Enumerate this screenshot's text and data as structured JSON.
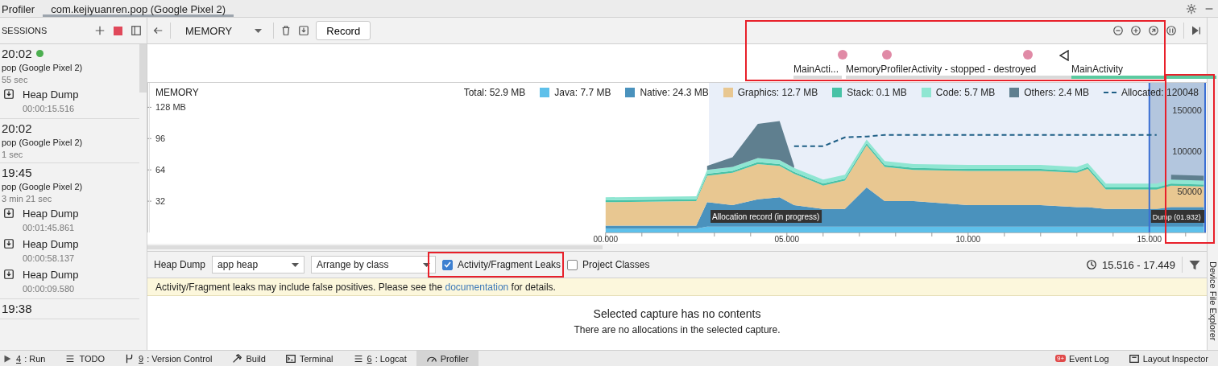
{
  "title_bar": {
    "tabs": [
      {
        "label": "Profiler",
        "selected": false
      },
      {
        "label": "com.kejiyuanren.pop (Google Pixel 2)",
        "selected": true
      }
    ]
  },
  "sessions": {
    "title": "SESSIONS",
    "items": [
      {
        "time": "20:02",
        "live": true,
        "device": "pop (Google Pixel 2)",
        "duration": "55 sec",
        "dumps": [
          {
            "label": "Heap Dump",
            "time": "00:00:15.516"
          }
        ]
      },
      {
        "time": "20:02",
        "live": false,
        "device": "pop (Google Pixel 2)",
        "duration": "1 sec"
      },
      {
        "time": "19:45",
        "live": false,
        "device": "pop (Google Pixel 2)",
        "duration": "3 min 21 sec",
        "dumps": [
          {
            "label": "Heap Dump",
            "time": "00:01:45.861"
          },
          {
            "label": "Heap Dump",
            "time": "00:00:58.137"
          },
          {
            "label": "Heap Dump",
            "time": "00:00:09.580"
          }
        ]
      },
      {
        "time": "19:38",
        "live": false
      }
    ]
  },
  "toolbar": {
    "profiler": "MEMORY",
    "record_button": "Record"
  },
  "events": {
    "highlighted": true,
    "marks": [
      {
        "kind": "touch"
      },
      {
        "kind": "touch"
      },
      {
        "kind": "touch"
      },
      {
        "kind": "back"
      }
    ],
    "activities": [
      {
        "label": "MainActi...",
        "active": false
      },
      {
        "label": "MemoryProfilerActivity - stopped - destroyed",
        "active": false
      },
      {
        "label": "MainActivity",
        "active": true
      }
    ]
  },
  "memory": {
    "title": "MEMORY",
    "total": "Total: 52.9 MB",
    "dump_highlighted": true,
    "ranges": [
      {
        "label": "Allocation record (in progress)"
      },
      {
        "label": "Dump (01.932)"
      }
    ],
    "chart_data": {
      "type": "area",
      "stacked": true,
      "xlim": [
        -12.64,
        16.56
      ],
      "ylim": [
        0,
        153
      ],
      "x": [
        0,
        2.5,
        2.8,
        3.5,
        4.2,
        4.8,
        5.2,
        6,
        6.6,
        7.2,
        7.7,
        8.5,
        10,
        12,
        13,
        13.3,
        13.8,
        15.2,
        15.6,
        16.5
      ],
      "xticks": [
        {
          "value": 0,
          "label": "00.000"
        },
        {
          "value": 5,
          "label": "05.000"
        },
        {
          "value": 10,
          "label": "10.000"
        },
        {
          "value": 15,
          "label": "15.000"
        }
      ],
      "yticks": [
        32,
        64,
        96,
        {
          "value": 128,
          "label": "128 MB"
        }
      ],
      "series": [
        {
          "name": "Java: 7.7 MB",
          "color": "#5ec0ea",
          "values": [
            4,
            4,
            6,
            6,
            6,
            6,
            6,
            6,
            6,
            6,
            6,
            6,
            6,
            6,
            6,
            6,
            6,
            6,
            6,
            6
          ]
        },
        {
          "name": "Native: 24.3 MB",
          "color": "#4a92bd",
          "values": [
            3,
            3,
            25,
            22,
            28,
            30,
            22,
            18,
            18,
            40,
            26,
            26,
            22,
            22,
            20,
            20,
            18,
            18,
            20,
            20
          ]
        },
        {
          "name": "Graphics: 12.7 MB",
          "color": "#e8c791",
          "values": [
            24,
            25,
            27,
            33,
            36,
            32,
            32,
            24,
            29,
            43,
            35,
            32,
            35,
            35,
            35,
            39,
            20,
            20,
            22,
            21
          ]
        },
        {
          "name": "Stack: 0.1 MB",
          "color": "#47c2a6",
          "values": [
            2,
            2,
            2,
            2,
            2,
            2,
            2,
            2,
            2,
            2,
            2,
            2,
            2,
            2,
            2,
            2,
            2,
            2,
            2,
            2
          ]
        },
        {
          "name": "Code: 5.7 MB",
          "color": "#8fe6d2",
          "values": [
            3,
            3,
            4,
            4,
            4,
            4,
            4,
            4,
            4,
            4,
            4,
            4,
            4,
            4,
            4,
            4,
            4,
            4,
            4,
            4
          ]
        },
        {
          "name": "Others: 2.4 MB",
          "color": "#5f7f8f",
          "values": [
            null,
            null,
            4,
            10,
            35,
            40,
            2,
            null,
            null,
            null,
            null,
            null,
            null,
            null,
            null,
            null,
            null,
            null,
            5,
            5
          ]
        }
      ]
    },
    "allocation": {
      "chart_data": {
        "type": "line",
        "xlim": [
          -12.64,
          16.56
        ],
        "ylim": [
          0,
          184000
        ],
        "x": [
          5.2,
          6,
          6.6,
          7.2,
          7.7,
          15.2
        ],
        "yticks": [
          50000,
          100000,
          150000
        ],
        "series": [
          {
            "name": "Allocated: 120048",
            "color": "#1f5f86",
            "line_style": "dashed",
            "values": [
              106000,
              106000,
              117000,
              118000,
              120000,
              120000
            ]
          }
        ]
      }
    }
  },
  "heap_toolbar": {
    "label": "Heap Dump",
    "heap_select": "app heap",
    "arrange_select": "Arrange by class",
    "checkboxes": [
      {
        "label": "Activity/Fragment Leaks",
        "checked": true,
        "highlighted": true
      },
      {
        "label": "Project Classes",
        "checked": false,
        "highlighted": false
      }
    ],
    "range": "15.516 - 17.449"
  },
  "banner": {
    "before": "Activity/Fragment leaks may include false positives. Please see the",
    "link": "documentation",
    "after": "for details."
  },
  "empty_state": {
    "title": "Selected capture has no contents",
    "message": "There are no allocations in the selected capture."
  },
  "side_strip": {
    "label": "Device File Explorer"
  },
  "status_bar": {
    "left": [
      {
        "mnemonic": "4",
        "label": ": Run",
        "selected": false
      },
      {
        "label": "TODO",
        "selected": false
      },
      {
        "mnemonic": "9",
        "label": ": Version Control",
        "selected": false
      },
      {
        "label": "Build",
        "selected": false
      },
      {
        "label": "Terminal",
        "selected": false
      },
      {
        "mnemonic": "6",
        "label": ": Logcat",
        "selected": false
      },
      {
        "label": "Profiler",
        "selected": true
      }
    ],
    "right": [
      {
        "label": "Event Log",
        "badge": "9+"
      },
      {
        "label": "Layout Inspector"
      }
    ]
  }
}
